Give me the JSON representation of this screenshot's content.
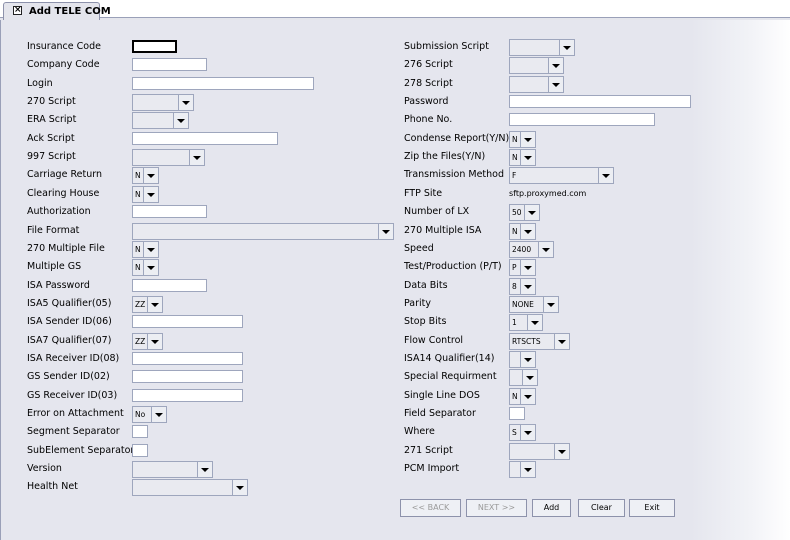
{
  "window": {
    "tab_title": "Add TELE COM"
  },
  "left_fields": [
    {
      "label": "Insurance Code",
      "kind": "text",
      "value": "",
      "focused": true
    },
    {
      "label": "Company Code",
      "kind": "text",
      "value": ""
    },
    {
      "label": "Login",
      "kind": "text",
      "value": ""
    },
    {
      "label": "270 Script",
      "kind": "combo",
      "value": ""
    },
    {
      "label": "ERA Script",
      "kind": "combo",
      "value": ""
    },
    {
      "label": "Ack Script",
      "kind": "text",
      "value": ""
    },
    {
      "label": "997 Script",
      "kind": "combo",
      "value": ""
    },
    {
      "label": "Carriage Return",
      "kind": "combo",
      "value": "N"
    },
    {
      "label": "Clearing House",
      "kind": "combo",
      "value": "N"
    },
    {
      "label": "Authorization",
      "kind": "text",
      "value": ""
    },
    {
      "label": "File Format",
      "kind": "combo",
      "value": ""
    },
    {
      "label": "270 Multiple File",
      "kind": "combo",
      "value": "N"
    },
    {
      "label": "Multiple GS",
      "kind": "combo",
      "value": "N"
    },
    {
      "label": "ISA Password",
      "kind": "text",
      "value": ""
    },
    {
      "label": "ISA5 Qualifier(05)",
      "kind": "combo",
      "value": "ZZ"
    },
    {
      "label": "ISA Sender ID(06)",
      "kind": "text",
      "value": ""
    },
    {
      "label": "ISA7 Qualifier(07)",
      "kind": "combo",
      "value": "ZZ"
    },
    {
      "label": "ISA Receiver ID(08)",
      "kind": "text",
      "value": ""
    },
    {
      "label": "GS Sender ID(02)",
      "kind": "text",
      "value": ""
    },
    {
      "label": "GS Receiver ID(03)",
      "kind": "text",
      "value": ""
    },
    {
      "label": "Error on Attachment",
      "kind": "combo",
      "value": "No"
    },
    {
      "label": "Segment Separator",
      "kind": "text",
      "value": ""
    },
    {
      "label": "SubElement Separator",
      "kind": "text",
      "value": ""
    },
    {
      "label": "Version",
      "kind": "combo",
      "value": ""
    },
    {
      "label": "Health Net",
      "kind": "combo",
      "value": ""
    }
  ],
  "right_fields": [
    {
      "label": "Submission Script",
      "kind": "combo",
      "value": ""
    },
    {
      "label": "276 Script",
      "kind": "combo",
      "value": ""
    },
    {
      "label": "278 Script",
      "kind": "combo",
      "value": ""
    },
    {
      "label": "Password",
      "kind": "text",
      "value": ""
    },
    {
      "label": "Phone No.",
      "kind": "text",
      "value": ""
    },
    {
      "label": "Condense Report(Y/N)",
      "kind": "combo",
      "value": "N"
    },
    {
      "label": "Zip the Files(Y/N)",
      "kind": "combo",
      "value": "N"
    },
    {
      "label": "Transmission Method",
      "kind": "combo",
      "value": "F"
    },
    {
      "label": "FTP Site",
      "kind": "static",
      "value": "sftp.proxymed.com"
    },
    {
      "label": "Number of LX",
      "kind": "combo",
      "value": "50"
    },
    {
      "label": "270 Multiple ISA",
      "kind": "combo",
      "value": "N"
    },
    {
      "label": "Speed",
      "kind": "combo",
      "value": "2400"
    },
    {
      "label": "Test/Production (P/T)",
      "kind": "combo",
      "value": "P"
    },
    {
      "label": "Data Bits",
      "kind": "combo",
      "value": "8"
    },
    {
      "label": "Parity",
      "kind": "combo",
      "value": "NONE"
    },
    {
      "label": "Stop Bits",
      "kind": "combo",
      "value": "1"
    },
    {
      "label": "Flow Control",
      "kind": "combo",
      "value": "RTSCTS"
    },
    {
      "label": "ISA14 Qualifier(14)",
      "kind": "combo",
      "value": ""
    },
    {
      "label": "Special Requirment",
      "kind": "combo",
      "value": ""
    },
    {
      "label": "Single Line DOS",
      "kind": "combo",
      "value": "N"
    },
    {
      "label": "Field Separator",
      "kind": "text",
      "value": ""
    },
    {
      "label": "Where",
      "kind": "combo",
      "value": "S"
    },
    {
      "label": "271 Script",
      "kind": "combo",
      "value": ""
    },
    {
      "label": "PCM Import",
      "kind": "combo",
      "value": ""
    }
  ],
  "buttons": [
    {
      "label": "<< BACK",
      "enabled": false
    },
    {
      "label": "NEXT >>",
      "enabled": false
    },
    {
      "label": "Add",
      "enabled": true
    },
    {
      "label": "Clear",
      "enabled": true
    },
    {
      "label": "Exit",
      "enabled": true
    }
  ],
  "icons": {
    "tab_close": "close-icon",
    "combo_arrow": "chevron-down-icon"
  }
}
